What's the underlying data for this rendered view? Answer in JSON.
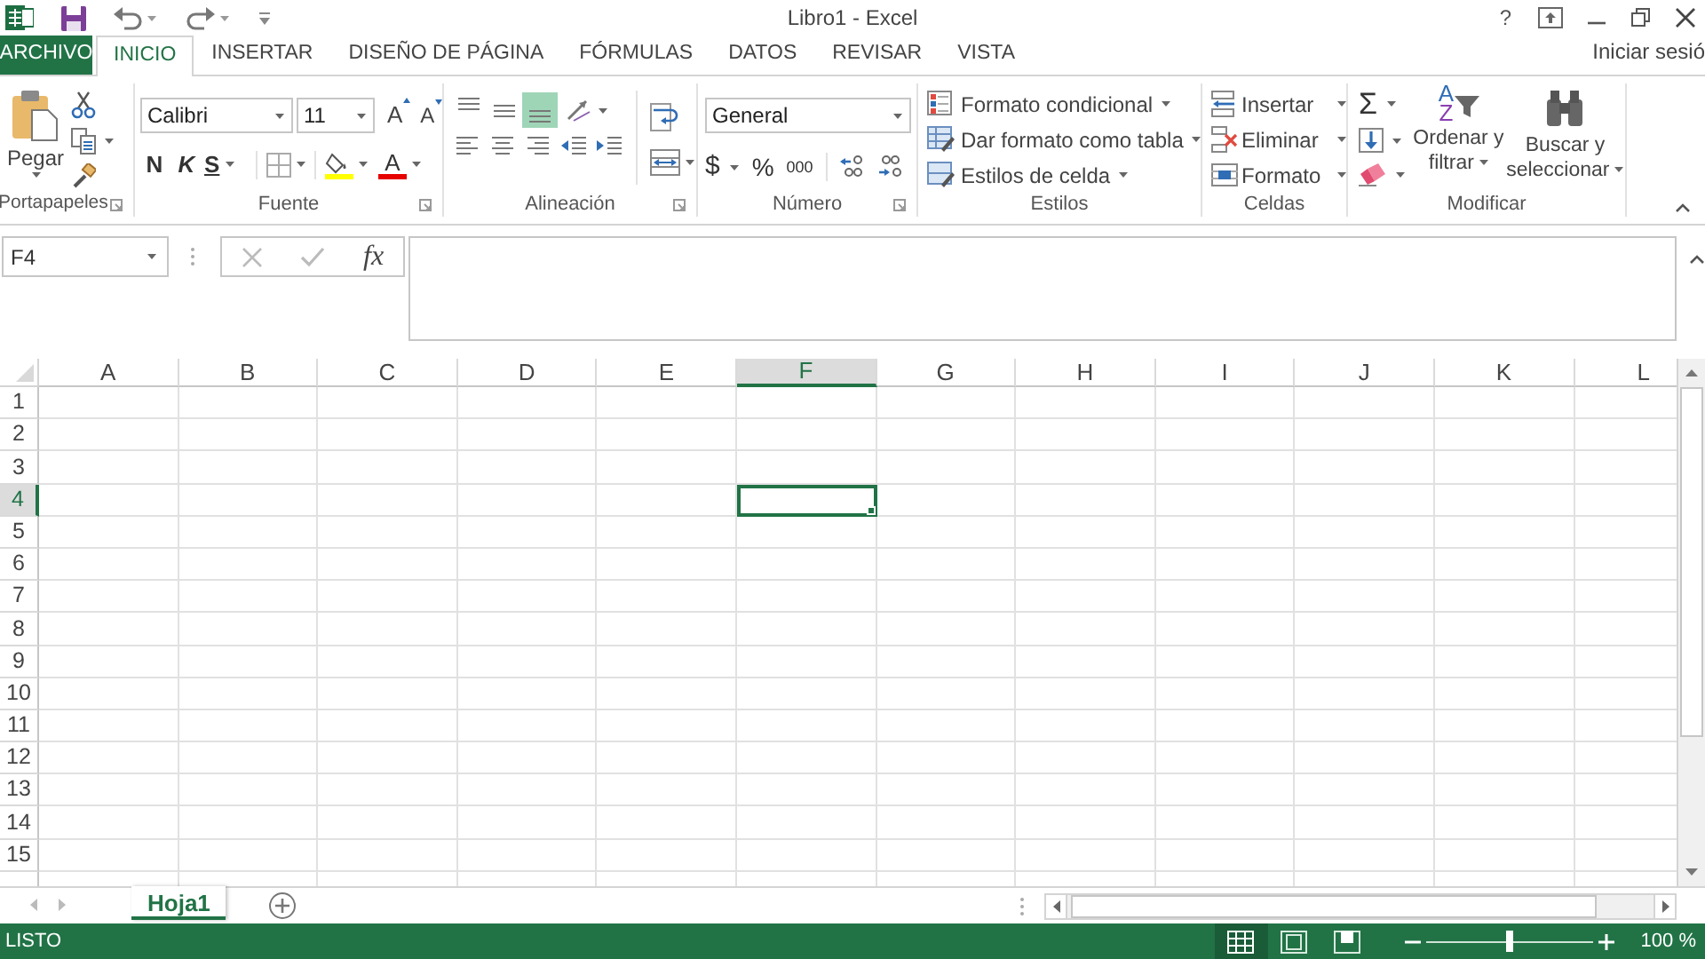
{
  "title_bar": {
    "title": "Libro1 - Excel",
    "help": "?"
  },
  "tabs": [
    {
      "label": "ARCHIVO",
      "kind": "file",
      "selected": false
    },
    {
      "label": "INICIO",
      "kind": "tab",
      "selected": true
    },
    {
      "label": "INSERTAR",
      "kind": "tab",
      "selected": false
    },
    {
      "label": "DISEÑO DE PÁGINA",
      "kind": "tab",
      "selected": false
    },
    {
      "label": "FÓRMULAS",
      "kind": "tab",
      "selected": false
    },
    {
      "label": "DATOS",
      "kind": "tab",
      "selected": false
    },
    {
      "label": "REVISAR",
      "kind": "tab",
      "selected": false
    },
    {
      "label": "VISTA",
      "kind": "tab",
      "selected": false
    }
  ],
  "account": "Iniciar sesió",
  "ribbon": {
    "clipboard": {
      "label": "Portapapeles",
      "paste": "Pegar"
    },
    "font": {
      "label": "Fuente",
      "font_name": "Calibri",
      "font_size": "11",
      "grow": "A",
      "shrink": "A",
      "bold": "N",
      "italic": "K",
      "underline": "S",
      "font_color": "A"
    },
    "alignment": {
      "label": "Alineación",
      "vertical": [
        {
          "selected": false
        },
        {
          "selected": false
        },
        {
          "selected": true
        }
      ]
    },
    "number": {
      "label": "Número",
      "format": "General",
      "currency": "$",
      "percent": "%",
      "thousands": "000"
    },
    "styles": {
      "label": "Estilos",
      "items": [
        "Formato condicional",
        "Dar formato como tabla",
        "Estilos de celda"
      ]
    },
    "cells": {
      "label": "Celdas",
      "items": [
        "Insertar",
        "Eliminar",
        "Formato"
      ]
    },
    "editing": {
      "label": "Modificar",
      "autosum": "Σ",
      "sort_letters": [
        "A",
        "Z"
      ],
      "sort": "Ordenar y filtrar",
      "find": "Buscar y seleccionar"
    }
  },
  "formula_bar": {
    "name_box": "F4",
    "function": "fx"
  },
  "sheet": {
    "columns": [
      {
        "label": "A",
        "selected": false
      },
      {
        "label": "B",
        "selected": false
      },
      {
        "label": "C",
        "selected": false
      },
      {
        "label": "D",
        "selected": false
      },
      {
        "label": "E",
        "selected": false
      },
      {
        "label": "F",
        "selected": true
      },
      {
        "label": "G",
        "selected": false
      },
      {
        "label": "H",
        "selected": false
      },
      {
        "label": "I",
        "selected": false
      },
      {
        "label": "J",
        "selected": false
      },
      {
        "label": "K",
        "selected": false
      },
      {
        "label": "L",
        "selected": false
      }
    ],
    "rows": [
      {
        "label": "1",
        "selected": false
      },
      {
        "label": "2",
        "selected": false
      },
      {
        "label": "3",
        "selected": false
      },
      {
        "label": "4",
        "selected": true
      },
      {
        "label": "5",
        "selected": false
      },
      {
        "label": "6",
        "selected": false
      },
      {
        "label": "7",
        "selected": false
      },
      {
        "label": "8",
        "selected": false
      },
      {
        "label": "9",
        "selected": false
      },
      {
        "label": "10",
        "selected": false
      },
      {
        "label": "11",
        "selected": false
      },
      {
        "label": "12",
        "selected": false
      },
      {
        "label": "13",
        "selected": false
      },
      {
        "label": "14",
        "selected": false
      },
      {
        "label": "15",
        "selected": false
      }
    ]
  },
  "sheet_tabs": [
    {
      "label": "Hoja1",
      "selected": true
    }
  ],
  "status_bar": {
    "status": "LISTO",
    "views": [
      {
        "kind": "normal",
        "selected": true
      },
      {
        "kind": "page_layout",
        "selected": false
      },
      {
        "kind": "page_break",
        "selected": false
      }
    ],
    "zoom": {
      "level": 0.5,
      "label": "100 %"
    }
  }
}
